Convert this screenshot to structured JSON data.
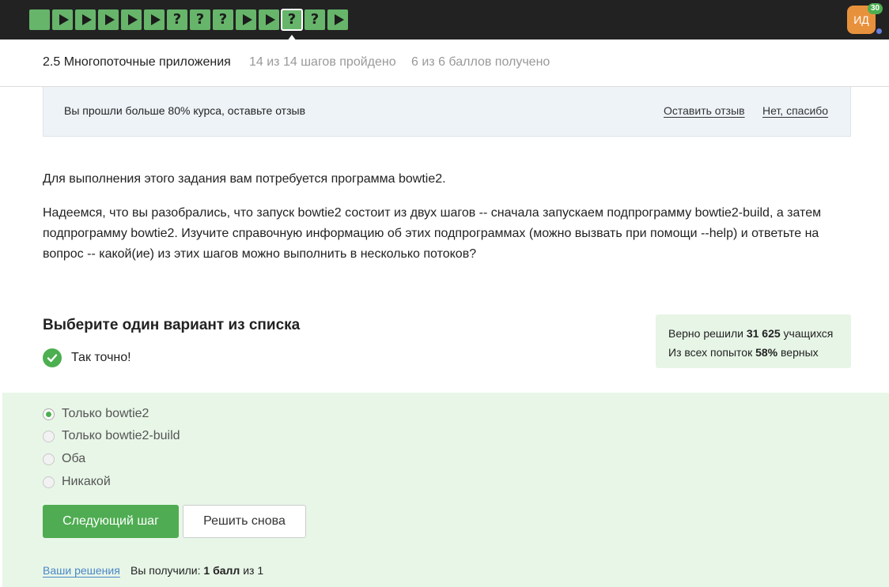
{
  "nav": {
    "steps": [
      {
        "type": "text"
      },
      {
        "type": "video"
      },
      {
        "type": "video"
      },
      {
        "type": "video"
      },
      {
        "type": "video"
      },
      {
        "type": "video"
      },
      {
        "type": "quiz",
        "glyph": "?"
      },
      {
        "type": "quiz",
        "glyph": "?"
      },
      {
        "type": "quiz",
        "glyph": "?"
      },
      {
        "type": "video"
      },
      {
        "type": "video"
      },
      {
        "type": "quiz",
        "glyph": "?",
        "active": true
      },
      {
        "type": "quiz",
        "glyph": "?"
      },
      {
        "type": "video"
      }
    ],
    "step_color": "#66b56a",
    "avatar": {
      "initials": "ИД",
      "badge": "30",
      "color": "#e8913c"
    }
  },
  "lesson": {
    "title": "2.5 Многопоточные приложения",
    "progress": "14 из 14 шагов пройдено",
    "score": "6 из 6 баллов  получено"
  },
  "banner": {
    "text": "Вы прошли больше 80% курса, оставьте отзыв",
    "leave_review": "Оставить отзыв",
    "no_thanks": "Нет, спасибо"
  },
  "task": {
    "paragraph1": "Для выполнения этого задания вам потребуется программа bowtie2.",
    "paragraph2": "Надеемся, что вы разобрались, что запуск bowtie2 состоит из двух шагов -- сначала запускаем подпрограмму bowtie2-build, а затем подпрограмму bowtie2. Изучите справочную информацию об этих подпрограммах (можно вызвать при помощи --help) и ответьте на вопрос -- какой(ие) из этих шагов можно выполнить в несколько потоков?"
  },
  "quiz": {
    "title": "Выберите один вариант из списка",
    "result": "Так точно!",
    "stats": {
      "solved_prefix": "Верно решили ",
      "solved_count": "31 625",
      "solved_suffix": " учащихся",
      "attempts_prefix": "Из всех попыток ",
      "attempts_percent": "58%",
      "attempts_suffix": " верных"
    },
    "options": [
      {
        "label": "Только bowtie2",
        "selected": true
      },
      {
        "label": "Только bowtie2-build",
        "selected": false
      },
      {
        "label": "Оба",
        "selected": false
      },
      {
        "label": "Никакой",
        "selected": false
      }
    ],
    "next_button": "Следующий шаг",
    "retry_button": "Решить снова",
    "your_solutions": "Ваши решения",
    "score_prefix": "Вы получили: ",
    "score_value": "1 балл",
    "score_suffix": " из 1"
  },
  "colors": {
    "accent_green": "#4fac52",
    "answer_bg": "#e8f6e7",
    "stats_bg": "#e7f5e6",
    "link_blue": "#4a86c7"
  }
}
